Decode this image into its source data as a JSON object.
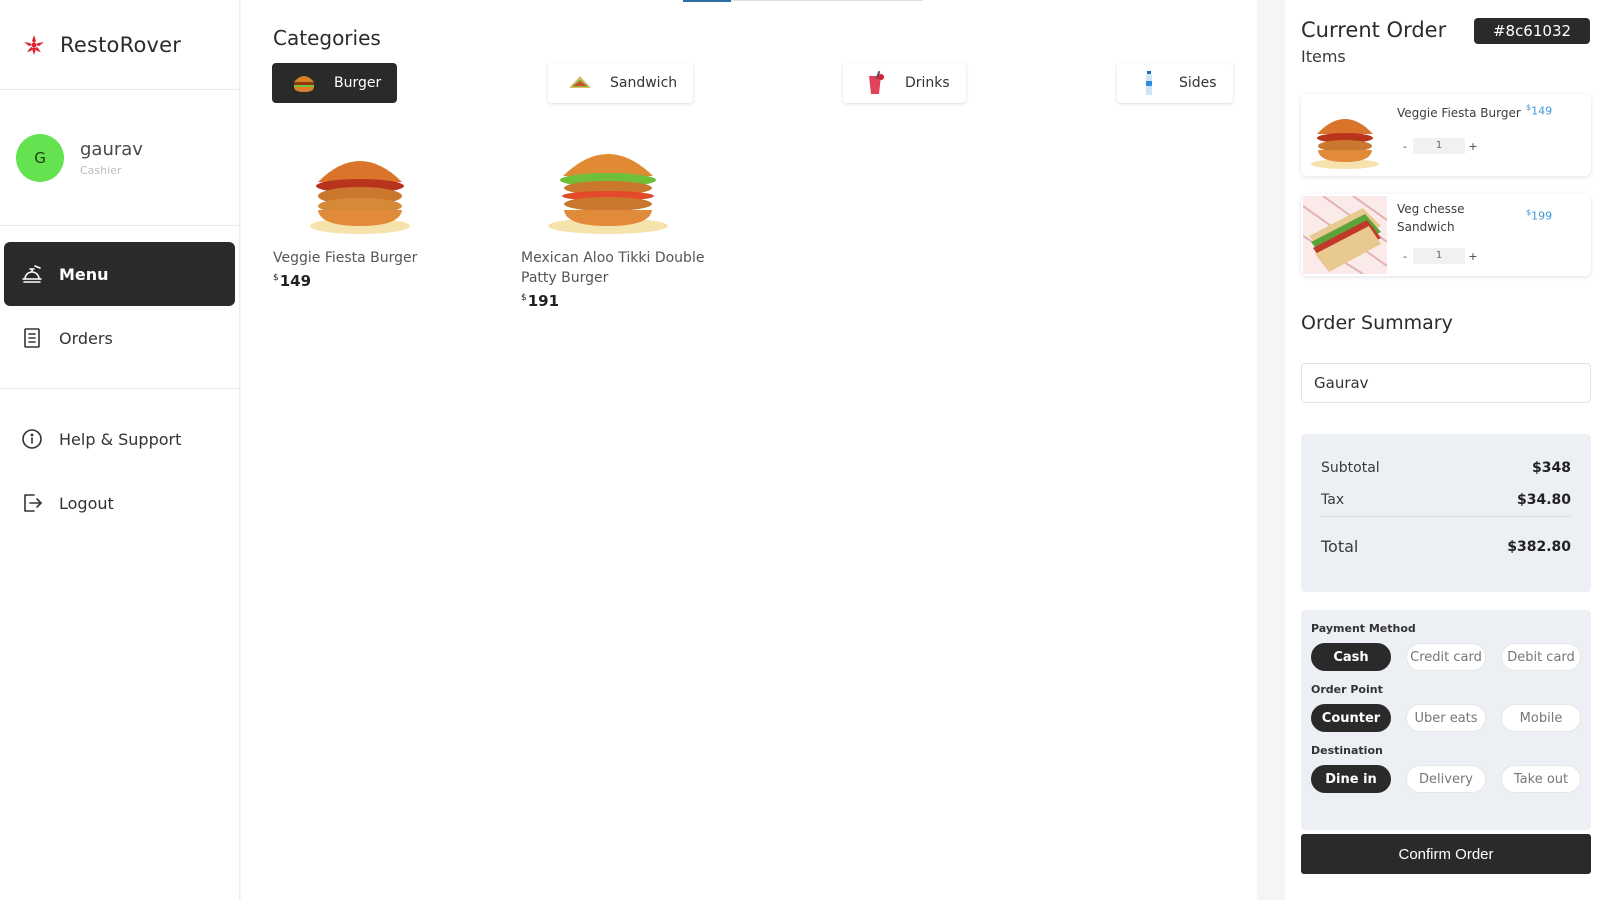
{
  "brand": {
    "name": "RestoRover"
  },
  "user": {
    "initial": "G",
    "name": "gaurav",
    "role": "Cashier"
  },
  "nav": {
    "menu": "Menu",
    "orders": "Orders",
    "help": "Help & Support",
    "logout": "Logout"
  },
  "main": {
    "categories_title": "Categories",
    "categories": [
      {
        "label": "Burger",
        "icon": "burger-icon",
        "active": true
      },
      {
        "label": "Sandwich",
        "icon": "sandwich-icon",
        "active": false
      },
      {
        "label": "Drinks",
        "icon": "drink-icon",
        "active": false
      },
      {
        "label": "Sides",
        "icon": "bottle-icon",
        "active": false
      }
    ],
    "products": [
      {
        "name": "Veggie Fiesta Burger",
        "currency": "$",
        "price": "149"
      },
      {
        "name": "Mexican Aloo Tikki Double Patty Burger",
        "currency": "$",
        "price": "191"
      }
    ]
  },
  "order": {
    "title": "Current Order",
    "id": "#8c61032",
    "items_label": "Items",
    "items": [
      {
        "name": "Veggie Fiesta Burger",
        "currency": "$",
        "price": "149",
        "qty": "1",
        "minus": "-",
        "plus": "+"
      },
      {
        "name": "Veg chesse Sandwich",
        "currency": "$",
        "price": "199",
        "qty": "1",
        "minus": "-",
        "plus": "+"
      }
    ],
    "summary_title": "Order Summary",
    "customer_name": "Gaurav",
    "subtotal_label": "Subtotal",
    "subtotal": "$348",
    "tax_label": "Tax",
    "tax": "$34.80",
    "total_label": "Total",
    "total": "$382.80",
    "payment_label": "Payment Method",
    "payment_options": [
      "Cash",
      "Credit card",
      "Debit card"
    ],
    "order_point_label": "Order Point",
    "order_point_options": [
      "Counter",
      "Uber eats",
      "Mobile"
    ],
    "destination_label": "Destination",
    "destination_options": [
      "Dine in",
      "Delivery",
      "Take out"
    ],
    "confirm_label": "Confirm Order"
  },
  "colors": {
    "dark": "#2a2a2a",
    "accent_price": "#3a9ad9",
    "avatar": "#64e24f",
    "brand_icon": "#e0242f",
    "panel_bg": "#eceff3"
  }
}
